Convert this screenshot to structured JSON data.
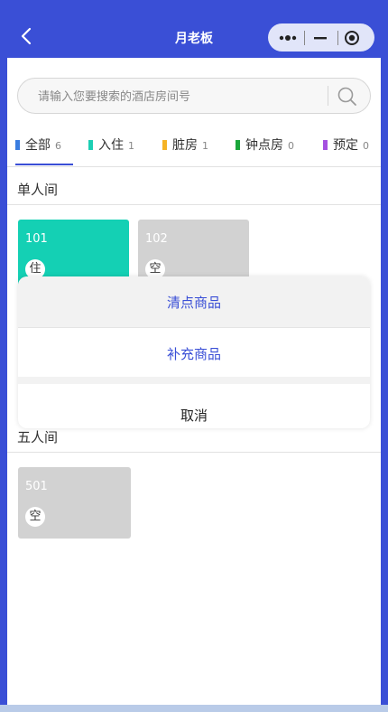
{
  "header": {
    "title": "月老板"
  },
  "search": {
    "placeholder": "请输入您要搜索的酒店房间号"
  },
  "tabs": [
    {
      "label": "全部",
      "count": "6",
      "color": "#3a7de0"
    },
    {
      "label": "入住",
      "count": "1",
      "color": "#1ccfb4"
    },
    {
      "label": "脏房",
      "count": "1",
      "color": "#f5b325"
    },
    {
      "label": "钟点房",
      "count": "0",
      "color": "#1aa63a"
    },
    {
      "label": "预定",
      "count": "0",
      "color": "#a550e0"
    }
  ],
  "sections": [
    {
      "title": "单人间",
      "rooms": [
        {
          "number": "101",
          "status": "住",
          "color": "#14d0b4"
        },
        {
          "number": "102",
          "status": "空",
          "color": "#d2d2d2"
        }
      ]
    },
    {
      "title": "五人间",
      "rooms": [
        {
          "number": "501",
          "status": "空",
          "color": "#d2d2d2"
        }
      ]
    }
  ],
  "action_sheet": {
    "items": [
      "清点商品",
      "补充商品"
    ],
    "cancel": "取消"
  },
  "colors": {
    "brand": "#3a4fd6"
  }
}
